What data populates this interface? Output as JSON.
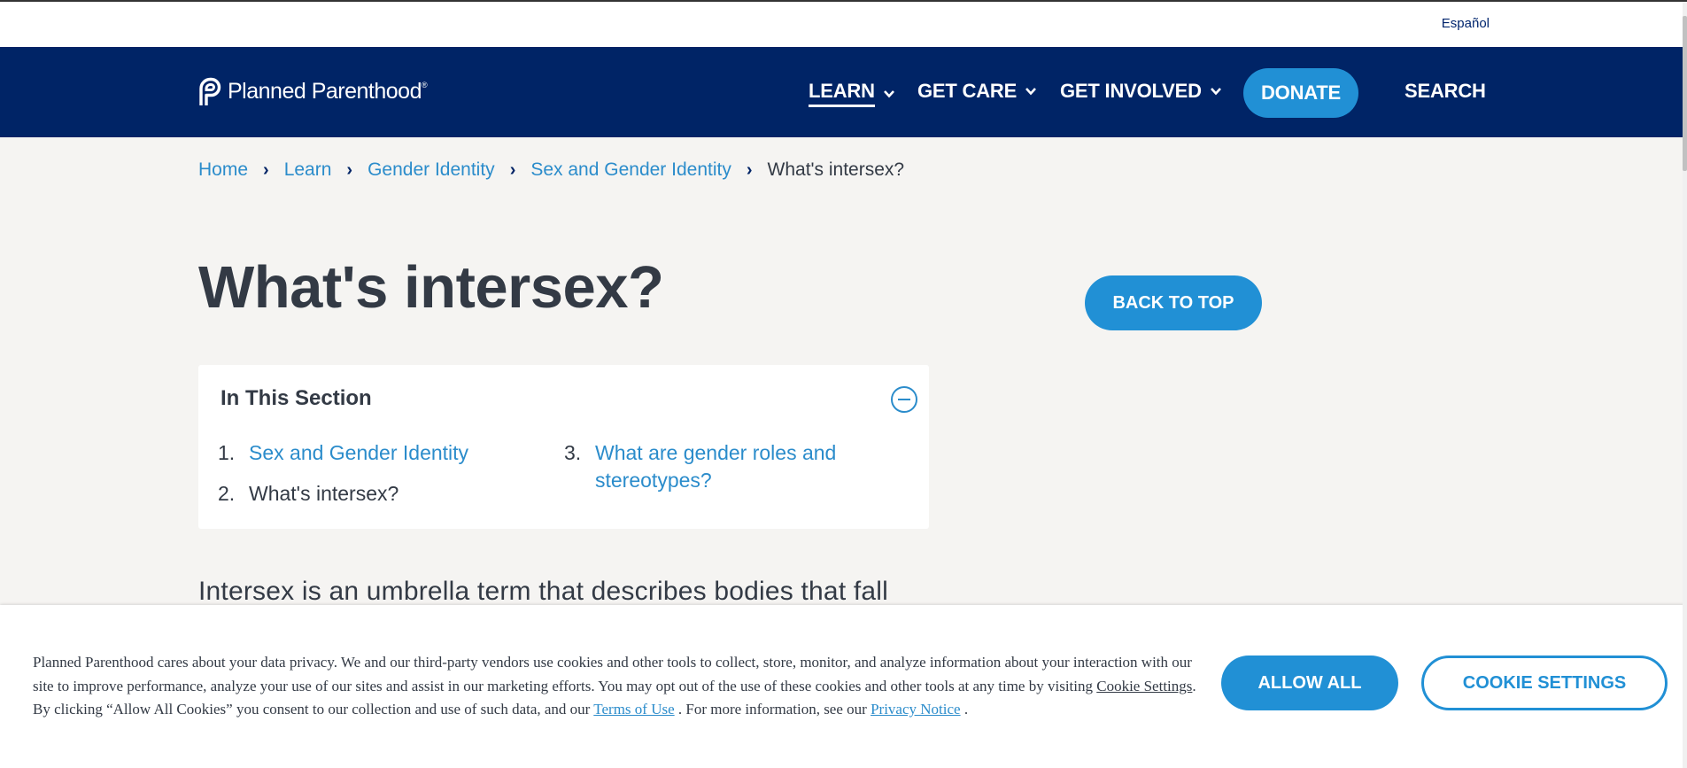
{
  "utility": {
    "language_link": "Español"
  },
  "header": {
    "logo_text": "Planned Parenthood",
    "logo_mark": "®",
    "nav": [
      {
        "label": "LEARN",
        "active": true
      },
      {
        "label": "GET CARE"
      },
      {
        "label": "GET INVOLVED"
      }
    ],
    "donate_label": "DONATE",
    "search_label": "SEARCH"
  },
  "breadcrumb": {
    "items": [
      "Home",
      "Learn",
      "Gender Identity",
      "Sex and Gender Identity"
    ],
    "current": "What's intersex?"
  },
  "page": {
    "title": "What's intersex?",
    "back_to_top": "BACK TO TOP",
    "intro": "Intersex is an umbrella term that describes bodies that fall"
  },
  "section": {
    "title": "In This Section",
    "items": [
      {
        "num": "1.",
        "label": "Sex and Gender Identity"
      },
      {
        "num": "2.",
        "label": "What's intersex?"
      },
      {
        "num": "3.",
        "label_line1": "What are gender roles and",
        "label_line2": "stereotypes?"
      }
    ]
  },
  "cookie": {
    "text_1": "Planned Parenthood cares about your data privacy. We and our third-party vendors use cookies and other tools to collect, store, monitor, and analyze information about your interaction with our site to improve performance, analyze your use of our sites and assist in our marketing efforts. You may opt out of the use of these cookies and other tools at any time by visiting ",
    "settings_link": "Cookie Settings",
    "text_2": ". By clicking “Allow All Cookies” you consent to our collection and use of such data, and our ",
    "terms_link": "Terms of Use",
    "text_3": " . For more information, see our ",
    "privacy_link": "Privacy Notice",
    "text_4": " .",
    "allow_label": "ALLOW ALL",
    "settings_label": "COOKIE SETTINGS"
  },
  "colors": {
    "navy": "#002466",
    "accent_blue": "#2190d5",
    "link_blue": "#2b8ccb",
    "page_bg": "#f5f4f2"
  },
  "icons": [
    "logo-icon",
    "chevron-down-icon",
    "breadcrumb-separator-icon",
    "collapse-minus-icon"
  ]
}
